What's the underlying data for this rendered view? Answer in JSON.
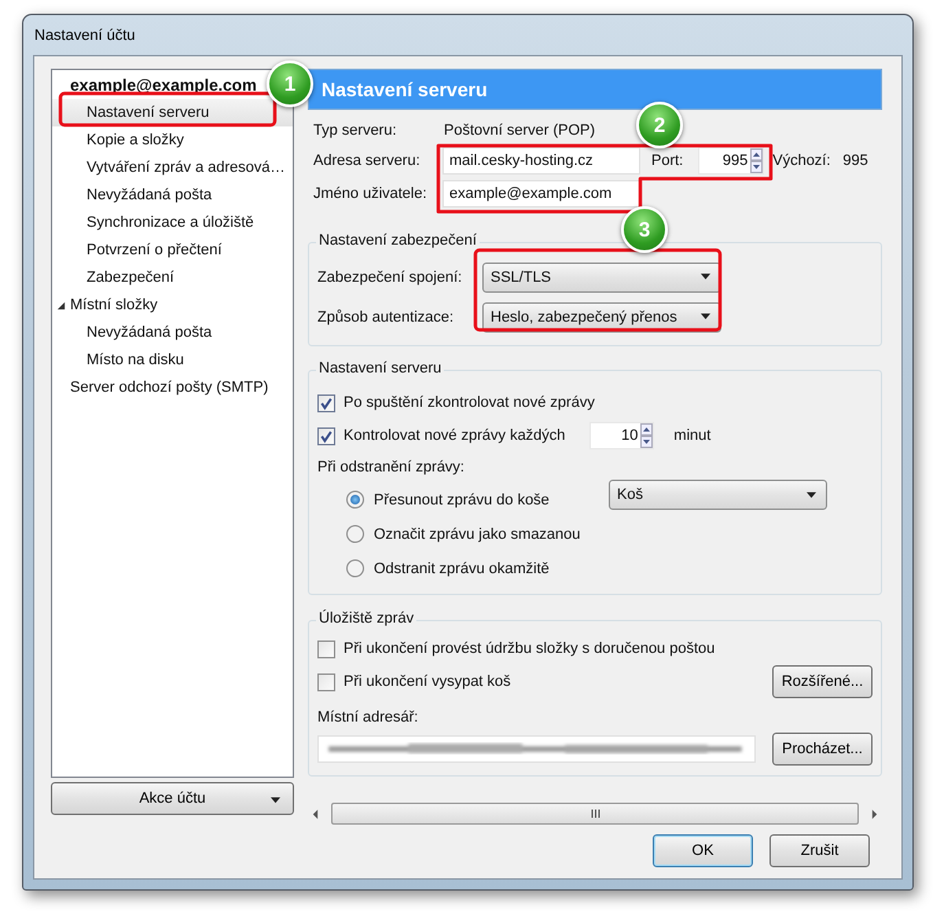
{
  "window": {
    "title": "Nastavení účtu"
  },
  "tree": [
    {
      "label": "example@example.com",
      "kind": "account",
      "selected": false,
      "children": [
        {
          "label": "Nastavení serveru",
          "selected": true
        },
        {
          "label": "Kopie a složky",
          "selected": false
        },
        {
          "label": "Vytváření zpráv a adresová…",
          "selected": false
        },
        {
          "label": "Nevyžádaná pošta",
          "selected": false
        },
        {
          "label": "Synchronizace a úložiště",
          "selected": false
        },
        {
          "label": "Potvrzení o přečtení",
          "selected": false
        },
        {
          "label": "Zabezpečení",
          "selected": false
        }
      ]
    },
    {
      "label": "Místní složky",
      "kind": "folder",
      "expanded": true,
      "selected": false,
      "children": [
        {
          "label": "Nevyžádaná pošta",
          "selected": false
        },
        {
          "label": "Místo na disku",
          "selected": false
        }
      ]
    },
    {
      "label": "Server odchozí pošty (SMTP)",
      "kind": "server",
      "selected": false
    }
  ],
  "account_actions_button": {
    "label": "Akce účtu"
  },
  "panel": {
    "title": "Nastavení serveru",
    "server_type": {
      "label": "Typ serveru:",
      "value": "Poštovní server  (POP)"
    },
    "server_address": {
      "label": "Adresa serveru:",
      "value": "mail.cesky-hosting.cz"
    },
    "port": {
      "label": "Port:",
      "value": "995",
      "default_label": "Výchozí:",
      "default_value": "995"
    },
    "username": {
      "label": "Jméno uživatele:",
      "value": "example@example.com"
    },
    "security": {
      "legend": "Nastavení zabezpečení",
      "fields": [
        {
          "label": "Zabezpečení spojení:",
          "value": "SSL/TLS"
        },
        {
          "label": "Způsob autentizace:",
          "value": "Heslo, zabezpečený přenos"
        }
      ]
    },
    "server_settings": {
      "legend": "Nastavení serveru",
      "check_on_startup": {
        "label": "Po spuštění zkontrolovat nové zprávy",
        "checked": true
      },
      "check_every": {
        "label": "Kontrolovat nové zprávy každých",
        "checked": true,
        "value": "10",
        "unit": "minut"
      },
      "on_delete_label": "Při odstranění zprávy:",
      "on_delete_options": [
        {
          "label": "Přesunout zprávu do koše",
          "selected": true
        },
        {
          "label": "Označit zprávu jako smazanou",
          "selected": false
        },
        {
          "label": "Odstranit zprávu okamžitě",
          "selected": false
        }
      ],
      "trash_folder": "Koš"
    },
    "storage": {
      "legend": "Úložiště zpráv",
      "options": [
        {
          "label": "Při ukončení provést údržbu složky s doručenou poštou",
          "checked": false
        },
        {
          "label": "Při ukončení vysypat koš",
          "checked": false
        }
      ],
      "advanced_button": "Rozšířené...",
      "local_dir_label": "Místní adresář:",
      "browse_button": "Procházet..."
    }
  },
  "buttons": [
    {
      "label": "OK",
      "default": true
    },
    {
      "label": "Zrušit",
      "default": false
    }
  ],
  "callouts": [
    {
      "number": "1"
    },
    {
      "number": "2"
    },
    {
      "number": "3"
    }
  ]
}
